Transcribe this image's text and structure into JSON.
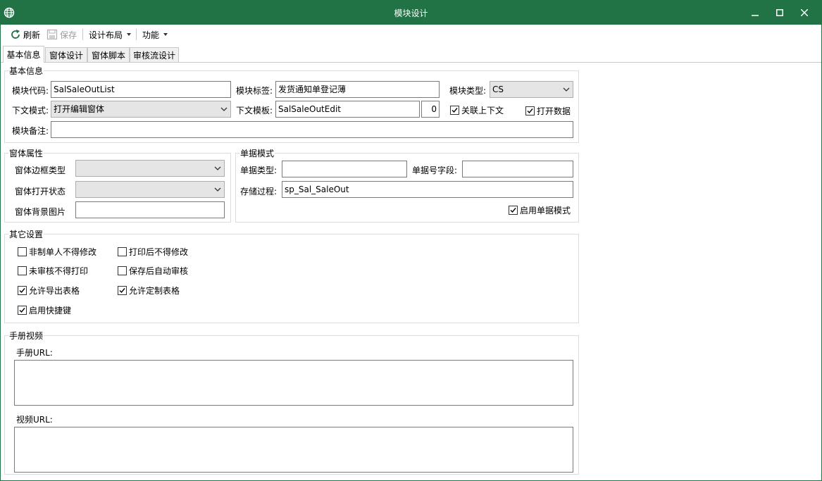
{
  "window": {
    "title": "模块设计"
  },
  "toolbar": {
    "refresh": "刷新",
    "save": "保存",
    "layout": "设计布局",
    "functions": "功能"
  },
  "tabs": [
    "基本信息",
    "窗体设计",
    "窗体脚本",
    "审核流设计"
  ],
  "basic": {
    "group_title": "基本信息",
    "code_label": "模块代码:",
    "code_value": "SalSaleOutList",
    "tag_label": "模块标签:",
    "tag_value": "发货通知单登记薄",
    "type_label": "模块类型:",
    "type_value": "CS",
    "mode_label": "下文模式:",
    "mode_value": "打开编辑窗体",
    "template_label": "下文模板:",
    "template_value": "SalSaleOutEdit",
    "template_num": "0",
    "link_context": "关联上下文",
    "open_data": "打开数据",
    "remark_label": "模块备注:",
    "remark_value": ""
  },
  "window_props": {
    "group_title": "窗体属性",
    "border_label": "窗体边框类型",
    "border_value": "",
    "open_state_label": "窗体打开状态",
    "open_state_value": "",
    "bg_label": "窗体背景图片",
    "bg_value": ""
  },
  "doc_mode": {
    "group_title": "单据模式",
    "doc_type_label": "单据类型:",
    "doc_type_value": "",
    "doc_no_label": "单据号字段:",
    "doc_no_value": "",
    "proc_label": "存储过程:",
    "proc_value": "sp_Sal_SaleOut",
    "enable_label": "启用单据模式"
  },
  "other": {
    "group_title": "其它设置",
    "opt1": "非制单人不得修改",
    "opt2": "打印后不得修改",
    "opt3": "未审核不得打印",
    "opt4": "保存后自动审核",
    "opt5": "允许导出表格",
    "opt6": "允许定制表格",
    "opt7": "启用快捷键"
  },
  "manual": {
    "group_title": "手册视频",
    "manual_url_label": "手册URL:",
    "manual_url_value": "",
    "video_url_label": "视频URL:",
    "video_url_value": ""
  },
  "colors": {
    "titlebar": "#217346",
    "accent": "#217346"
  }
}
